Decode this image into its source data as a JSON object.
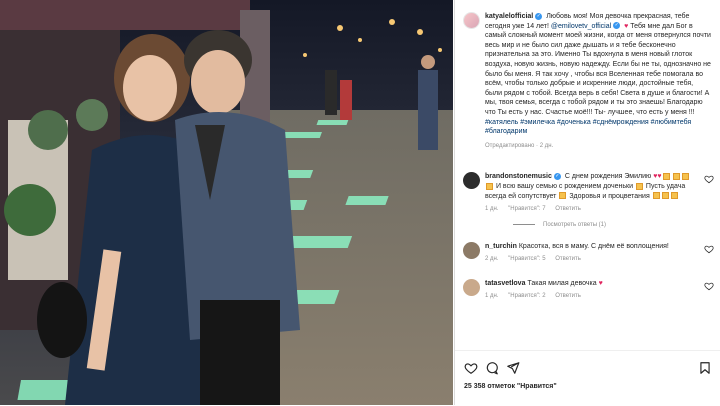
{
  "caption": {
    "username": "katyalelofficial",
    "text_1": "Любовь моя! Моя девочка прекрасная, тебе сегодня уже 14 лет!",
    "mention": "@emilovetv_official",
    "text_2": "Тебя мне дал Бог в самый сложный момент моей жизни, когда от меня отвернулся почти весь мир и не было сил даже дышать и я тебе бесконечно признательна за это. Именно Ты вдохнула в меня новый глоток воздуха, новую жизнь, новую надежду. Если бы не ты, однозначно не было бы меня. Я так хочу , чтобы вся Вселенная тебе помогала во всём, чтобы только добрые и искренние люди, достойные тебя, были рядом с тобой. Всегда верь в себя! Света в душе и благости! А мы, твоя семья, всегда с тобой рядом и ты это знаешь! Благодарю что Ты есть у нас. Счастье моё!!! Ты- лучшее, что есть у меня !!!",
    "hashtags": "#катялель #эмилечка #доченька #сднёмрождения #любимтебя #благодарим",
    "edited": "Отредактировано · 2 дн."
  },
  "comments": [
    {
      "username": "brandonstonemusic",
      "text_a": "С днем рождения Эмилию",
      "text_b": "И всю вашу семью с рождением доченьки",
      "text_c": "Пусть удача всегда ей сопутствует",
      "text_d": "Здоровья и процветания",
      "time": "1 дн.",
      "likes": "\"Нравится\": 7",
      "reply": "Ответить",
      "view_replies": "Посмотреть ответы (1)"
    },
    {
      "username": "n_turchin",
      "text": "Красотка, вся в маму. С днём её воплощения!",
      "time": "2 дн.",
      "likes": "\"Нравится\": 5",
      "reply": "Ответить"
    },
    {
      "username": "tatasvetlova",
      "text": "Такая милая девочка",
      "time": "1 дн.",
      "likes": "\"Нравится\": 2",
      "reply": "Ответить"
    }
  ],
  "likes_count": "25 358 отметок \"Нравится\"",
  "icons": [
    "heart-icon",
    "comment-icon",
    "share-icon",
    "save-icon"
  ],
  "colors": {
    "link": "#00376b",
    "muted": "#8e8e8e",
    "verified": "#3897f0",
    "heart_red": "#e0245e"
  }
}
